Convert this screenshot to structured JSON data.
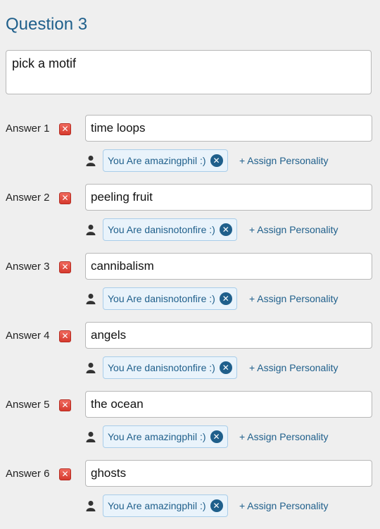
{
  "question": {
    "title": "Question 3",
    "text": "pick a motif"
  },
  "answers": [
    {
      "label": "Answer 1",
      "value": "time loops",
      "personality": "You Are amazingphil :)",
      "assign": "+ Assign Personality"
    },
    {
      "label": "Answer 2",
      "value": "peeling fruit",
      "personality": "You Are danisnotonfire :)",
      "assign": "+ Assign Personality"
    },
    {
      "label": "Answer 3",
      "value": "cannibalism",
      "personality": "You Are danisnotonfire :)",
      "assign": "+ Assign Personality"
    },
    {
      "label": "Answer 4",
      "value": "angels",
      "personality": "You Are danisnotonfire :)",
      "assign": "+ Assign Personality"
    },
    {
      "label": "Answer 5",
      "value": "the ocean",
      "personality": "You Are amazingphil :)",
      "assign": "+ Assign Personality"
    },
    {
      "label": "Answer 6",
      "value": "ghosts",
      "personality": "You Are amazingphil :)",
      "assign": "+ Assign Personality"
    }
  ],
  "icons": {
    "delete": "delete-icon",
    "person": "person-icon",
    "remove": "remove-circle-icon"
  },
  "colors": {
    "accent": "#1f5f8b",
    "delete": "#e04a3f",
    "tag_background": "#e9f3fb",
    "page_background": "#efefef"
  }
}
